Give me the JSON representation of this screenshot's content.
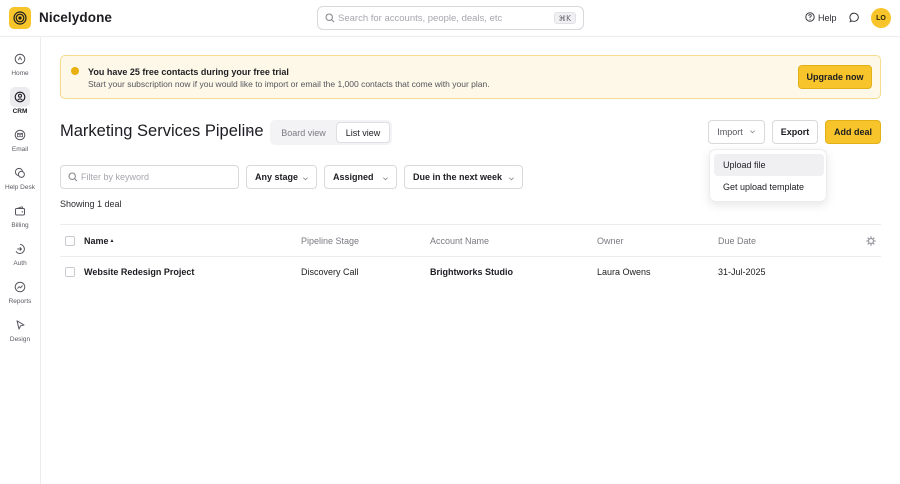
{
  "app": {
    "name": "Nicelydone",
    "avatar_initials": "LO"
  },
  "search": {
    "placeholder": "Search for accounts, people, deals, etc",
    "shortcut": "⌘K"
  },
  "header": {
    "help_label": "Help"
  },
  "sidebar": {
    "items": [
      {
        "label": "Home",
        "icon": "home-icon",
        "active": false
      },
      {
        "label": "CRM",
        "icon": "crm-icon",
        "active": true
      },
      {
        "label": "Email",
        "icon": "email-icon",
        "active": false
      },
      {
        "label": "Help Desk",
        "icon": "help-desk-icon",
        "active": false
      },
      {
        "label": "Billing",
        "icon": "billing-icon",
        "active": false
      },
      {
        "label": "Auth",
        "icon": "auth-icon",
        "active": false
      },
      {
        "label": "Reports",
        "icon": "reports-icon",
        "active": false
      },
      {
        "label": "Design",
        "icon": "design-icon",
        "active": false
      }
    ]
  },
  "banner": {
    "title": "You have 25 free contacts during your free trial",
    "text": "Start your subscription now if you would like to import or email the 1,000 contacts that come with your plan.",
    "button": "Upgrade now"
  },
  "page": {
    "title": "Marketing Services Pipeline",
    "views": {
      "board": "Board view",
      "list": "List view",
      "selected": "List view"
    },
    "import_label": "Import",
    "export_label": "Export",
    "add_label": "Add deal"
  },
  "import_menu": {
    "items": [
      "Upload file",
      "Get upload template"
    ]
  },
  "filters": {
    "keyword_placeholder": "Filter by keyword",
    "stage": "Any stage",
    "assigned": "Assigned",
    "due": "Due in the next week"
  },
  "results": {
    "showing": "Showing 1 deal"
  },
  "table": {
    "columns": [
      "Name",
      "Pipeline Stage",
      "Account Name",
      "Owner",
      "Due Date"
    ],
    "sort_indicator": "▲",
    "rows": [
      {
        "name": "Website Redesign Project",
        "stage": "Discovery Call",
        "account": "Brightworks Studio",
        "owner": "Laura Owens",
        "due": "31-Jul-2025"
      }
    ]
  },
  "colors": {
    "accent": "#f7c52b",
    "banner_bg": "#fdf8e7",
    "banner_border": "#f4dc8c"
  }
}
